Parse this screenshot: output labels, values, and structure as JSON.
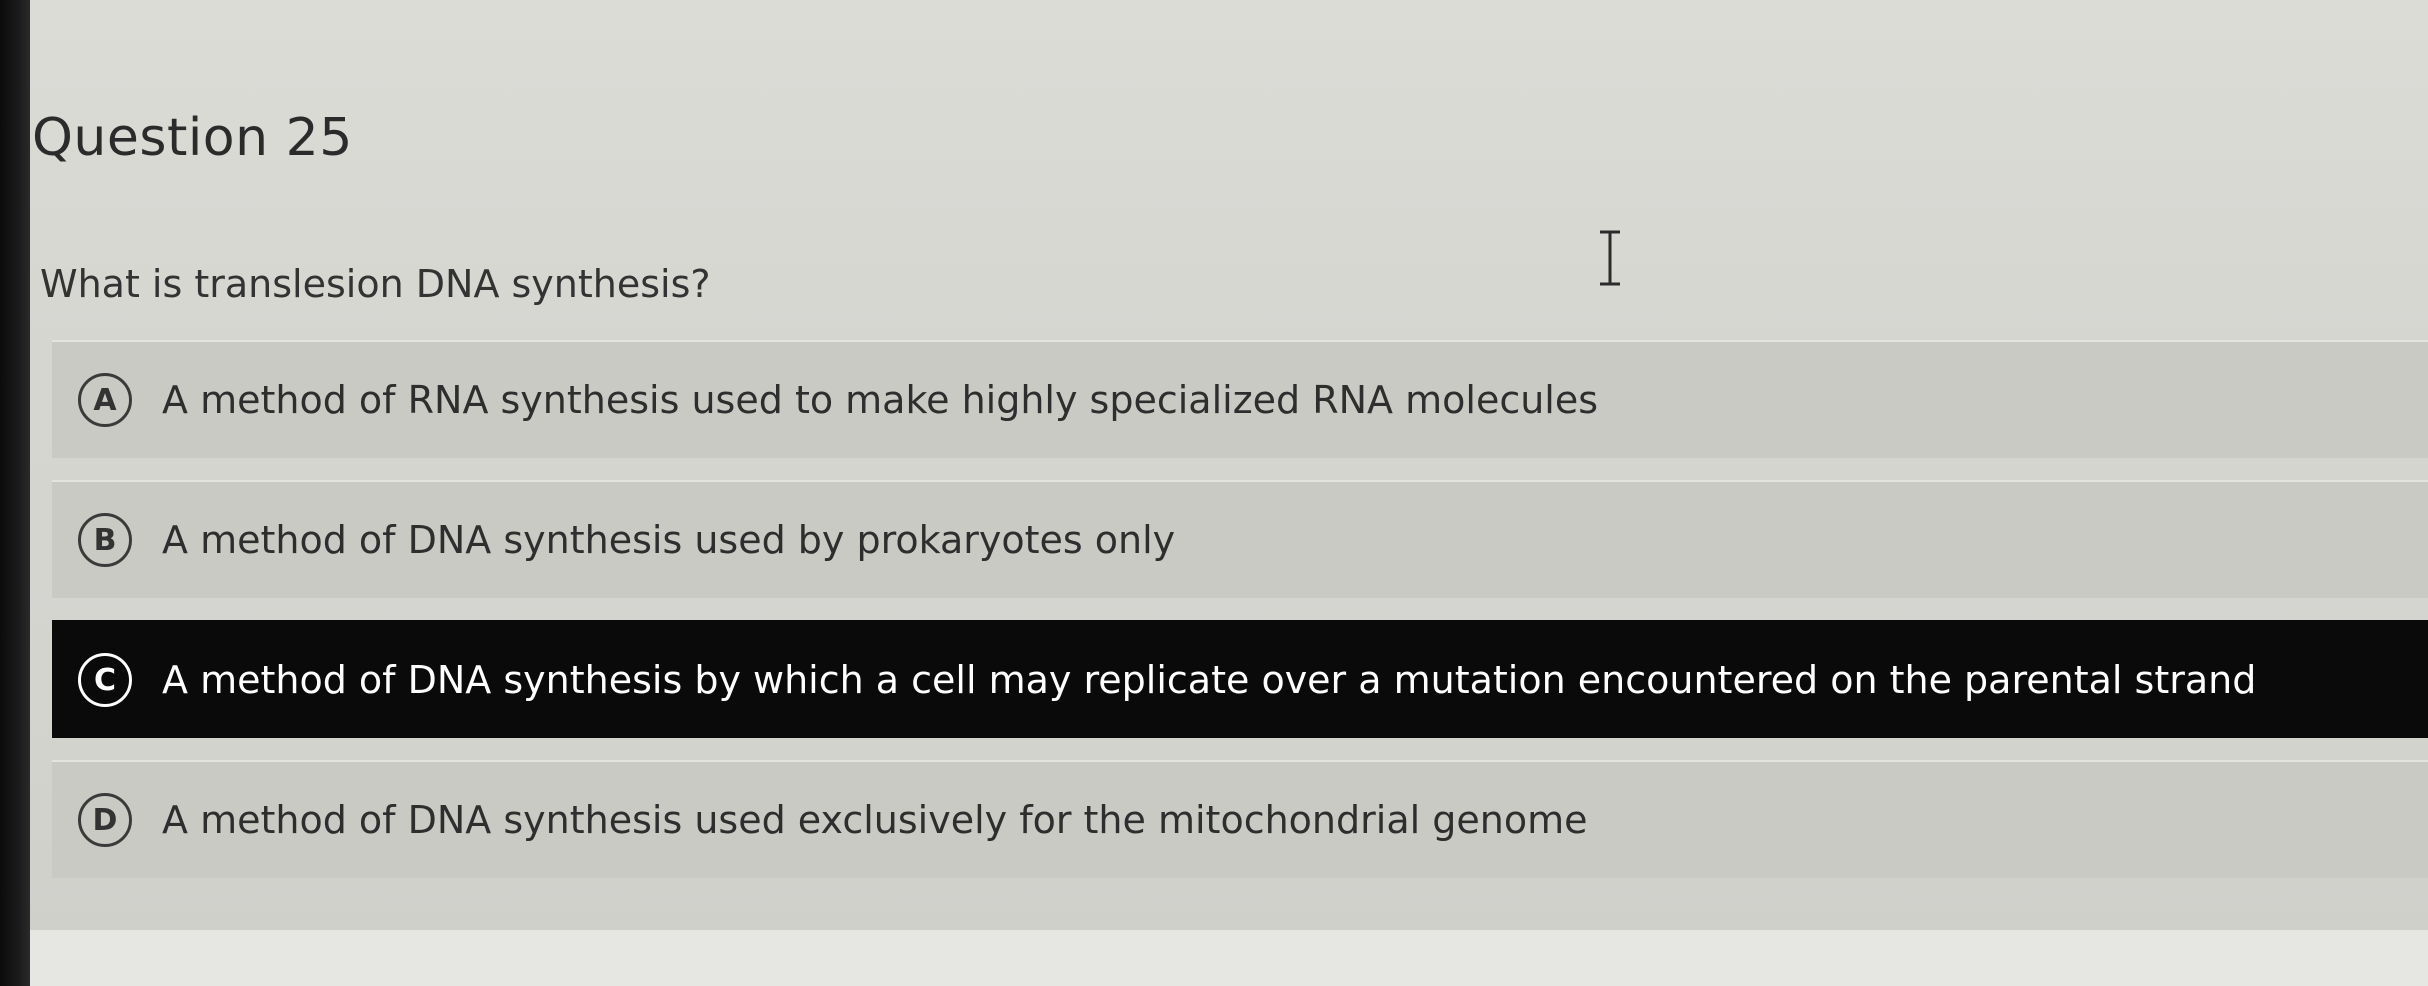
{
  "question": {
    "title": "Question 25",
    "prompt": "What is translesion DNA synthesis?"
  },
  "options": [
    {
      "letter": "A",
      "text": "A method of RNA synthesis used to make highly specialized RNA molecules",
      "selected": false
    },
    {
      "letter": "B",
      "text": "A method of DNA synthesis used by prokaryotes only",
      "selected": false
    },
    {
      "letter": "C",
      "text": "A method of DNA synthesis by which a cell may replicate over a mutation encountered on the parental strand",
      "selected": true
    },
    {
      "letter": "D",
      "text": "A method of DNA synthesis used exclusively for the mitochondrial genome",
      "selected": false
    }
  ],
  "icons": {
    "cursor": "text-cursor-icon"
  },
  "colors": {
    "selected_background": "#0a0a0a",
    "option_background": "#cacac5",
    "page_background": "#d6d6d1"
  }
}
